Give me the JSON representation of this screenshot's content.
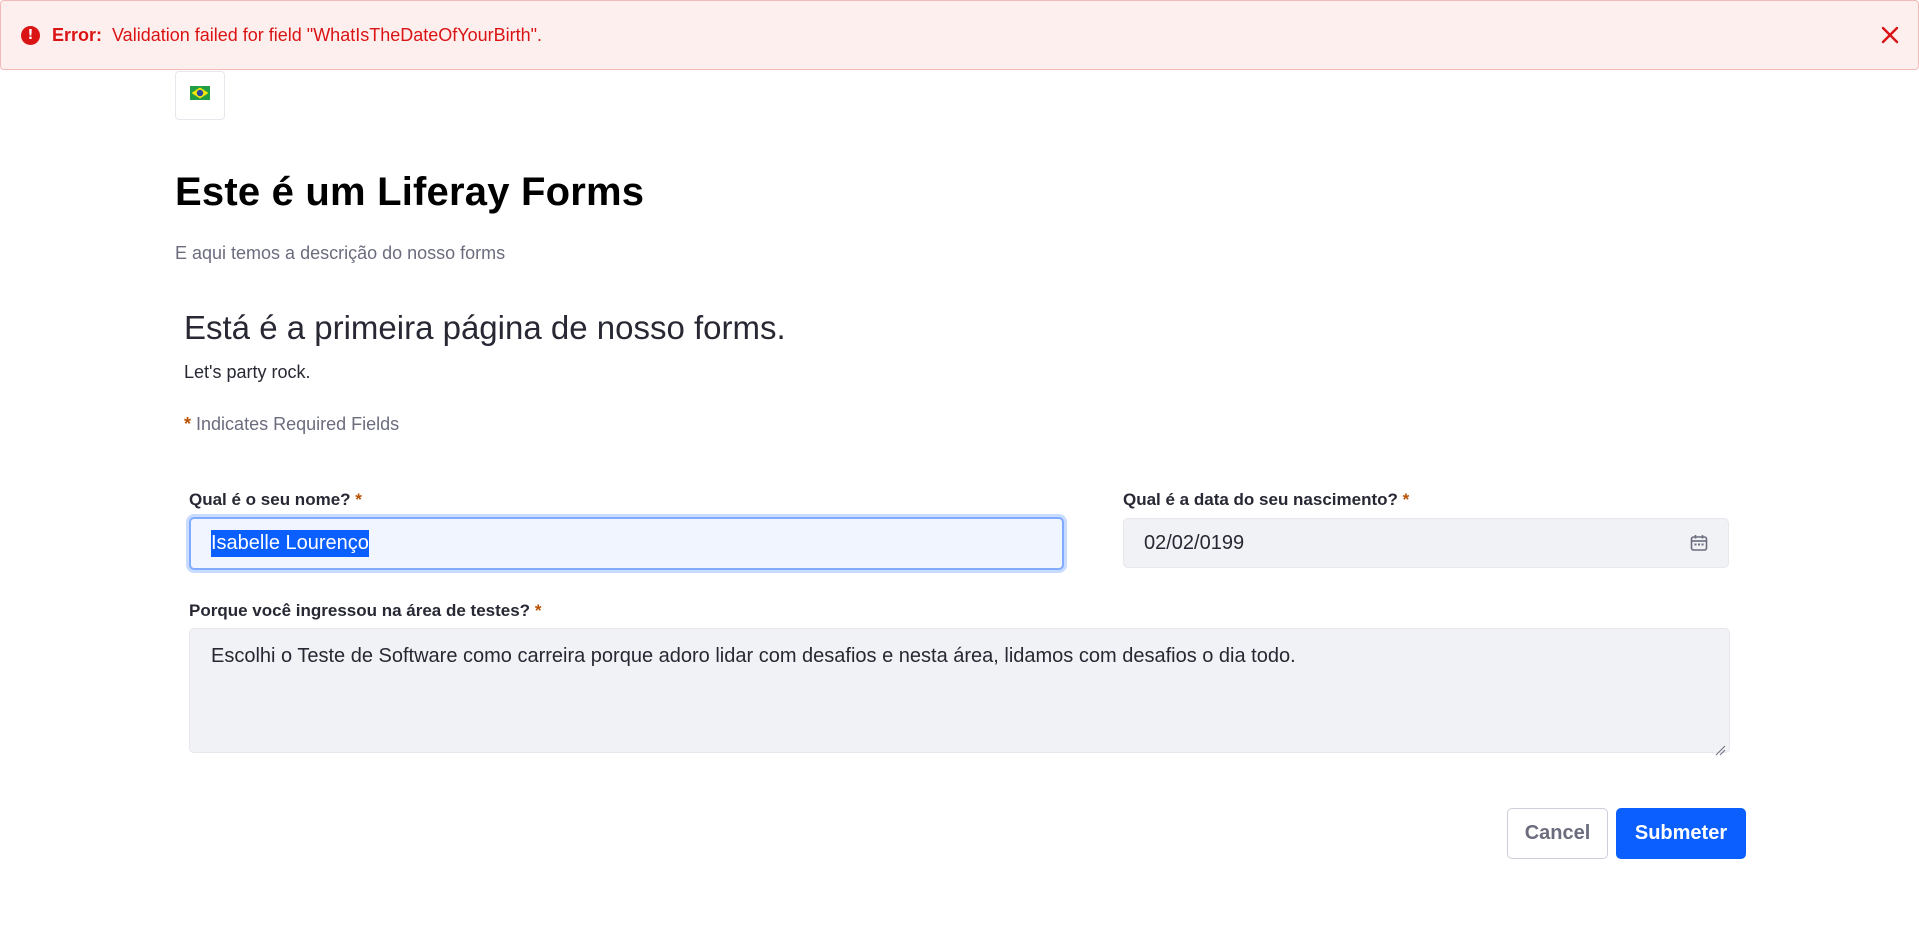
{
  "alert": {
    "icon": "exclamation-circle-icon",
    "lead": "Error:",
    "message": "Validation failed for field \"WhatIsTheDateOfYourBirth\".",
    "close_icon": "close-icon",
    "color": "#da1414"
  },
  "language_selector": {
    "icon": "brazil-flag-icon"
  },
  "form": {
    "title": "Este é um Liferay Forms",
    "description": "E aqui temos a descrição do nosso forms"
  },
  "page": {
    "title": "Está é a primeira página de nosso forms.",
    "description": "Let's party rock.",
    "required_star": "*",
    "required_note": "Indicates Required Fields"
  },
  "fields": {
    "name": {
      "label": "Qual é o seu nome?",
      "required": "*",
      "value": "Isabelle Lourenço"
    },
    "birth_date": {
      "label": "Qual é a data do seu nascimento?",
      "required": "*",
      "value": "02/02/0199",
      "icon": "calendar-icon"
    },
    "reason": {
      "label": "Porque você ingressou na área de testes?",
      "required": "*",
      "value": "Escolhi o Teste de Software como carreira porque adoro lidar com desafios e nesta área, lidamos com desafios o dia todo."
    }
  },
  "actions": {
    "cancel_label": "Cancel",
    "submit_label": "Submeter",
    "primary_color": "#0b5fff"
  }
}
